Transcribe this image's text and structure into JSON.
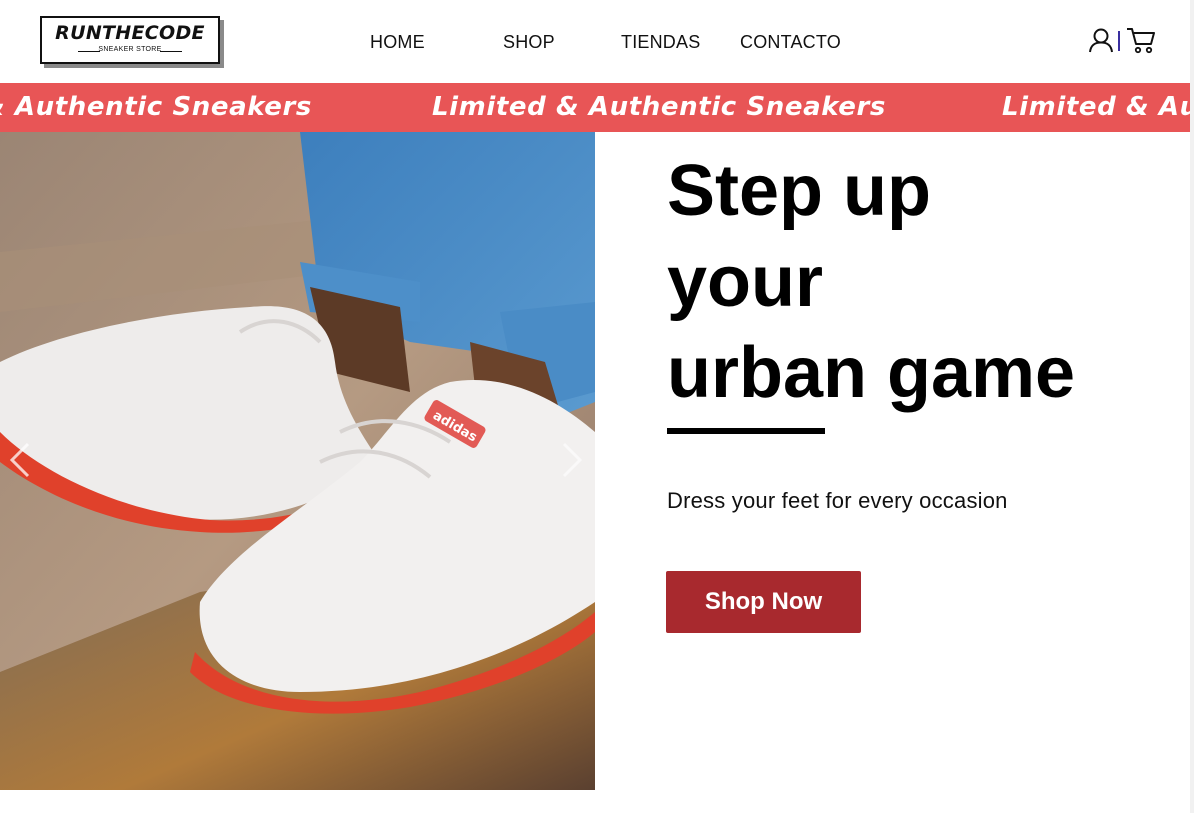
{
  "header": {
    "logo": {
      "name": "RUNTHECODE",
      "tagline": "SNEAKER STORE"
    },
    "nav": [
      {
        "label": "HOME"
      },
      {
        "label": "SHOP"
      },
      {
        "label": "TIENDAS"
      },
      {
        "label": "CONTACTO"
      }
    ],
    "icons": {
      "account": "user-icon",
      "cart": "cart-icon"
    }
  },
  "marquee": {
    "items": [
      "& Authentic Sneakers",
      "Limited & Authentic Sneakers",
      "Limited & Au"
    ],
    "background": "#e85556",
    "text_color": "#ffffff"
  },
  "hero": {
    "headline": [
      "Step up",
      "your",
      "urban game"
    ],
    "subtitle": "Dress your feet for every occasion",
    "cta_label": "Shop Now",
    "cta_color": "#a8292e",
    "carousel": {
      "prev_icon": "chevron-left-icon",
      "next_icon": "chevron-right-icon"
    },
    "image_brand_text": "adidas"
  }
}
